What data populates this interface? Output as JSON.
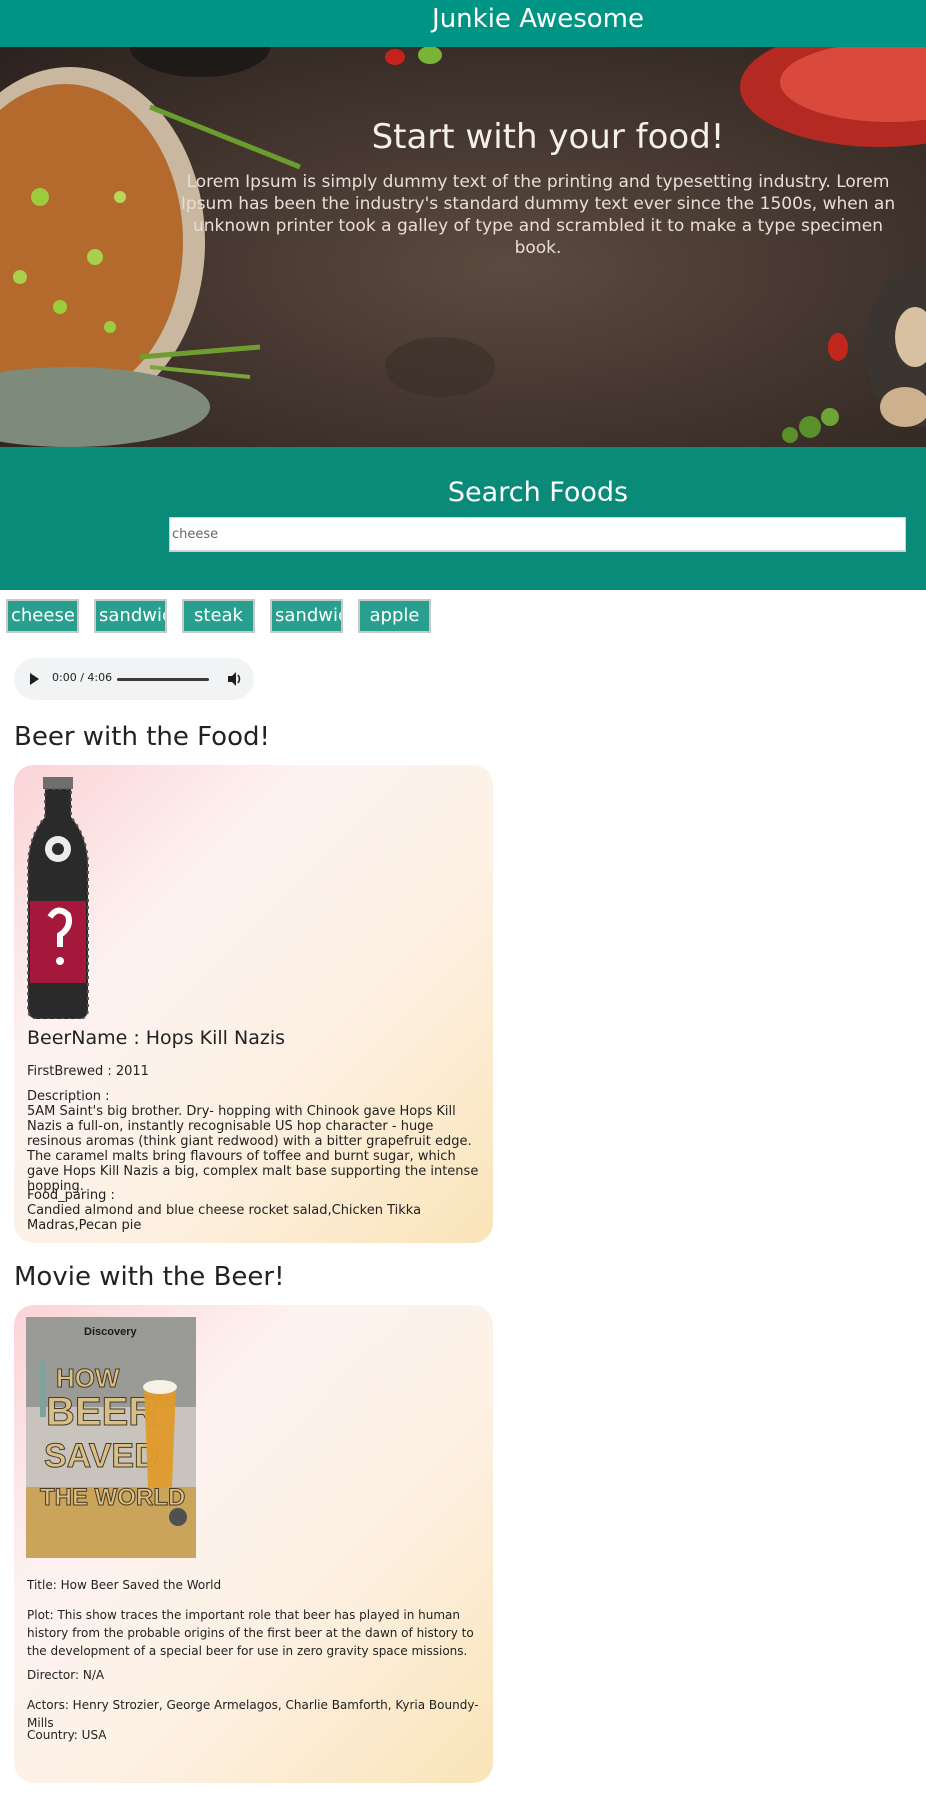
{
  "app": {
    "title": "Junkie Awesome"
  },
  "hero": {
    "heading": "Start with your food!",
    "text": "Lorem Ipsum is simply dummy text of the printing and typesetting industry. Lorem Ipsum has been the industry's standard dummy text ever since the 1500s, when an unknown printer took a galley of type and scrambled it to make a type specimen book."
  },
  "search": {
    "heading": "Search Foods",
    "value": "cheese",
    "chips": [
      "cheese",
      "sandwich",
      "steak",
      "sandwich",
      "apple"
    ]
  },
  "audio": {
    "time": "0:00 / 4:06"
  },
  "beer_section": {
    "heading": "Beer with the Food!",
    "name": "BeerName : Hops Kill Nazis",
    "first_brewed": "FirstBrewed : 2011",
    "description_label": "Description :",
    "description": "5AM Saint's big brother. Dry- hopping with Chinook gave Hops Kill Nazis a full-on, instantly recognisable US hop character - huge resinous aromas (think giant redwood) with a bitter grapefruit edge. The caramel malts bring flavours of toffee and burnt sugar, which gave Hops Kill Nazis a big, complex malt base supporting the intense hopping.",
    "food_label": "Food_paring :",
    "food": "Candied almond and blue cheese rocket salad,Chicken Tikka Madras,Pecan pie",
    "image_icon": "beer-bottle-image"
  },
  "movie_section": {
    "heading": "Movie with the Beer!",
    "poster_text": {
      "brand": "Discovery",
      "line1": "HOW",
      "line2": "BEER",
      "line3": "SAVED",
      "line4": "THE WORLD"
    },
    "title": "Title: How Beer Saved the World",
    "plot": "Plot: This show traces the important role that beer has played in human history from the probable origins of the first beer at the dawn of history to the development of a special beer for use in zero gravity space missions.",
    "director": "Director: N/A",
    "actors": "Actors: Henry Strozier, George Armelagos, Charlie Bamforth, Kyria Boundy-Mills",
    "country": "Country: USA"
  },
  "colors": {
    "navbar": "#009485",
    "search_band": "#0a8b79",
    "chip": "#29a08f",
    "card_gradient_start": "#fbd3d6",
    "card_gradient_end": "#fae4b8"
  }
}
